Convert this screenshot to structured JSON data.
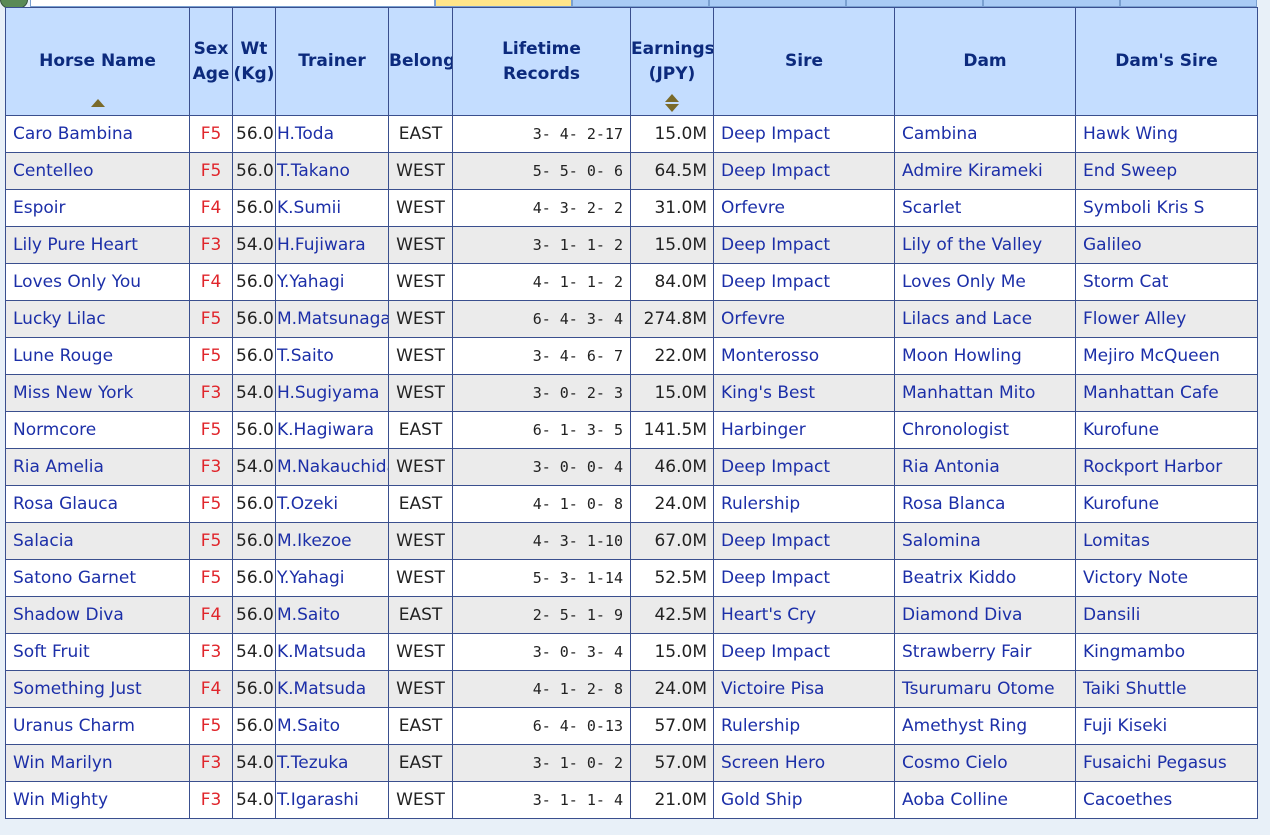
{
  "colors": {
    "header_bg": "#c4ddff",
    "header_text": "#0c2a7d",
    "link": "#1c2fa8",
    "sex": "#e0252b",
    "row_alt": "#ebebeb",
    "border": "#3a4f8e",
    "active_tab": "#ffe58a",
    "tab": "#a9cbf5"
  },
  "header": {
    "horse_name": "Horse Name",
    "sex": "Sex",
    "age": "Age",
    "wt": "Wt",
    "wt_unit": "(Kg)",
    "trainer": "Trainer",
    "belong": "Belong",
    "lifetime": "Lifetime",
    "records": "Records",
    "earnings": "Earnings",
    "earnings_unit": "(JPY)",
    "sire": "Sire",
    "dam": "Dam",
    "dams_sire": "Dam's Sire"
  },
  "rows": [
    {
      "name": "Caro Bambina",
      "sex": "F5",
      "wt": "56.0",
      "trainer": "H.Toda",
      "belong": "EAST",
      "record": "3- 4- 2-17",
      "earnings": "15.0M",
      "sire": "Deep Impact",
      "dam": "Cambina",
      "dams_sire": "Hawk Wing"
    },
    {
      "name": "Centelleo",
      "sex": "F5",
      "wt": "56.0",
      "trainer": "T.Takano",
      "belong": "WEST",
      "record": "5- 5- 0- 6",
      "earnings": "64.5M",
      "sire": "Deep Impact",
      "dam": "Admire Kirameki",
      "dams_sire": "End Sweep"
    },
    {
      "name": "Espoir",
      "sex": "F4",
      "wt": "56.0",
      "trainer": "K.Sumii",
      "belong": "WEST",
      "record": "4- 3- 2- 2",
      "earnings": "31.0M",
      "sire": "Orfevre",
      "dam": "Scarlet",
      "dams_sire": "Symboli Kris S"
    },
    {
      "name": "Lily Pure Heart",
      "sex": "F3",
      "wt": "54.0",
      "trainer": "H.Fujiwara",
      "belong": "WEST",
      "record": "3- 1- 1- 2",
      "earnings": "15.0M",
      "sire": "Deep Impact",
      "dam": "Lily of the Valley",
      "dams_sire": "Galileo"
    },
    {
      "name": "Loves Only You",
      "sex": "F4",
      "wt": "56.0",
      "trainer": "Y.Yahagi",
      "belong": "WEST",
      "record": "4- 1- 1- 2",
      "earnings": "84.0M",
      "sire": "Deep Impact",
      "dam": "Loves Only Me",
      "dams_sire": "Storm Cat"
    },
    {
      "name": "Lucky Lilac",
      "sex": "F5",
      "wt": "56.0",
      "trainer": "M.Matsunaga",
      "belong": "WEST",
      "record": "6- 4- 3- 4",
      "earnings": "274.8M",
      "sire": "Orfevre",
      "dam": "Lilacs and Lace",
      "dams_sire": "Flower Alley"
    },
    {
      "name": "Lune Rouge",
      "sex": "F5",
      "wt": "56.0",
      "trainer": "T.Saito",
      "belong": "WEST",
      "record": "3- 4- 6- 7",
      "earnings": "22.0M",
      "sire": "Monterosso",
      "dam": "Moon Howling",
      "dams_sire": "Mejiro McQueen"
    },
    {
      "name": "Miss New York",
      "sex": "F3",
      "wt": "54.0",
      "trainer": "H.Sugiyama",
      "belong": "WEST",
      "record": "3- 0- 2- 3",
      "earnings": "15.0M",
      "sire": "King's Best",
      "dam": "Manhattan Mito",
      "dams_sire": "Manhattan Cafe"
    },
    {
      "name": "Normcore",
      "sex": "F5",
      "wt": "56.0",
      "trainer": "K.Hagiwara",
      "belong": "EAST",
      "record": "6- 1- 3- 5",
      "earnings": "141.5M",
      "sire": "Harbinger",
      "dam": "Chronologist",
      "dams_sire": "Kurofune"
    },
    {
      "name": "Ria Amelia",
      "sex": "F3",
      "wt": "54.0",
      "trainer": "M.Nakauchida",
      "belong": "WEST",
      "record": "3- 0- 0- 4",
      "earnings": "46.0M",
      "sire": "Deep Impact",
      "dam": "Ria Antonia",
      "dams_sire": "Rockport Harbor"
    },
    {
      "name": "Rosa Glauca",
      "sex": "F5",
      "wt": "56.0",
      "trainer": "T.Ozeki",
      "belong": "EAST",
      "record": "4- 1- 0- 8",
      "earnings": "24.0M",
      "sire": "Rulership",
      "dam": "Rosa Blanca",
      "dams_sire": "Kurofune"
    },
    {
      "name": "Salacia",
      "sex": "F5",
      "wt": "56.0",
      "trainer": "M.Ikezoe",
      "belong": "WEST",
      "record": "4- 3- 1-10",
      "earnings": "67.0M",
      "sire": "Deep Impact",
      "dam": "Salomina",
      "dams_sire": "Lomitas"
    },
    {
      "name": "Satono Garnet",
      "sex": "F5",
      "wt": "56.0",
      "trainer": "Y.Yahagi",
      "belong": "WEST",
      "record": "5- 3- 1-14",
      "earnings": "52.5M",
      "sire": "Deep Impact",
      "dam": "Beatrix Kiddo",
      "dams_sire": "Victory Note"
    },
    {
      "name": "Shadow Diva",
      "sex": "F4",
      "wt": "56.0",
      "trainer": "M.Saito",
      "belong": "EAST",
      "record": "2- 5- 1- 9",
      "earnings": "42.5M",
      "sire": "Heart's Cry",
      "dam": "Diamond Diva",
      "dams_sire": "Dansili"
    },
    {
      "name": "Soft Fruit",
      "sex": "F3",
      "wt": "54.0",
      "trainer": "K.Matsuda",
      "belong": "WEST",
      "record": "3- 0- 3- 4",
      "earnings": "15.0M",
      "sire": "Deep Impact",
      "dam": "Strawberry Fair",
      "dams_sire": "Kingmambo"
    },
    {
      "name": "Something Just",
      "sex": "F4",
      "wt": "56.0",
      "trainer": "K.Matsuda",
      "belong": "WEST",
      "record": "4- 1- 2- 8",
      "earnings": "24.0M",
      "sire": "Victoire Pisa",
      "dam": "Tsurumaru Otome",
      "dams_sire": "Taiki Shuttle"
    },
    {
      "name": "Uranus Charm",
      "sex": "F5",
      "wt": "56.0",
      "trainer": "M.Saito",
      "belong": "EAST",
      "record": "6- 4- 0-13",
      "earnings": "57.0M",
      "sire": "Rulership",
      "dam": "Amethyst Ring",
      "dams_sire": "Fuji Kiseki"
    },
    {
      "name": "Win Marilyn",
      "sex": "F3",
      "wt": "54.0",
      "trainer": "T.Tezuka",
      "belong": "EAST",
      "record": "3- 1- 0- 2",
      "earnings": "57.0M",
      "sire": "Screen Hero",
      "dam": "Cosmo Cielo",
      "dams_sire": "Fusaichi Pegasus"
    },
    {
      "name": "Win Mighty",
      "sex": "F3",
      "wt": "54.0",
      "trainer": "T.Igarashi",
      "belong": "WEST",
      "record": "3- 1- 1- 4",
      "earnings": "21.0M",
      "sire": "Gold Ship",
      "dam": "Aoba Colline",
      "dams_sire": "Cacoethes"
    }
  ]
}
